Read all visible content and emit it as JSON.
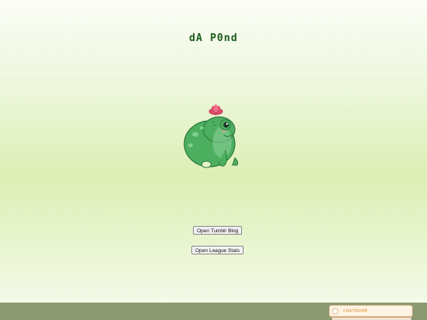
{
  "page": {
    "title": "dA P0nd"
  },
  "mascot": {
    "icon": "frog-with-flower-icon"
  },
  "buttons": {
    "tumblr": "Open Tumblr Blog",
    "league": "Open League Stats"
  },
  "footer": {
    "chat_label": "CHATROOM"
  },
  "colors": {
    "title": "#1e5e1e",
    "frog": "#4caf5f",
    "flower": "#e0556e",
    "footer": "#8b9a70",
    "chat_text": "#d98b2b"
  }
}
